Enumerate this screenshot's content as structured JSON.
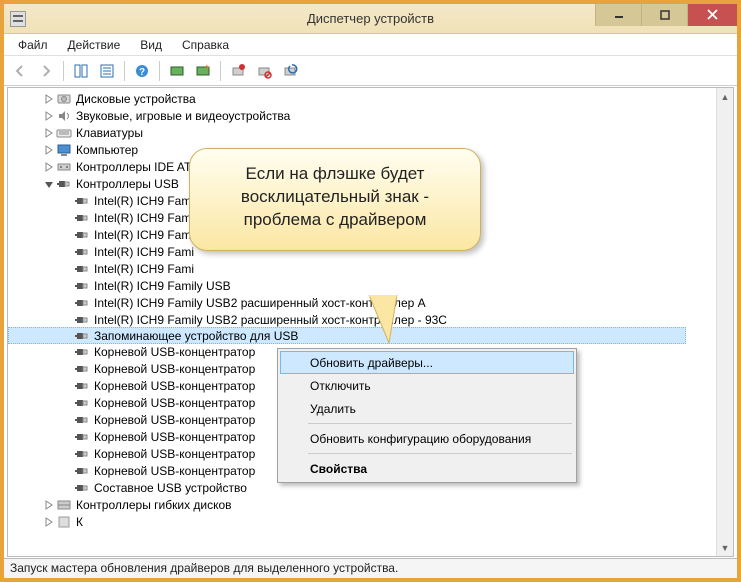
{
  "window": {
    "title": "Диспетчер устройств"
  },
  "menu": {
    "items": [
      "Файл",
      "Действие",
      "Вид",
      "Справка"
    ]
  },
  "tree": {
    "nodes": [
      {
        "indent": 1,
        "exp": "closed",
        "icon": "disk",
        "label": "Дисковые устройства"
      },
      {
        "indent": 1,
        "exp": "closed",
        "icon": "sound",
        "label": "Звуковые, игровые и видеоустройства"
      },
      {
        "indent": 1,
        "exp": "closed",
        "icon": "keyboard",
        "label": "Клавиатуры"
      },
      {
        "indent": 1,
        "exp": "closed",
        "icon": "computer",
        "label": "Компьютер"
      },
      {
        "indent": 1,
        "exp": "closed",
        "icon": "ide",
        "label": "Контроллеры IDE ATA"
      },
      {
        "indent": 1,
        "exp": "open",
        "icon": "usb",
        "label": "Контроллеры USB"
      },
      {
        "indent": 2,
        "exp": "none",
        "icon": "usb",
        "label": "Intel(R) ICH9 Fami"
      },
      {
        "indent": 2,
        "exp": "none",
        "icon": "usb",
        "label": "Intel(R) ICH9 Fami"
      },
      {
        "indent": 2,
        "exp": "none",
        "icon": "usb",
        "label": "Intel(R) ICH9 Fami"
      },
      {
        "indent": 2,
        "exp": "none",
        "icon": "usb",
        "label": "Intel(R) ICH9 Fami"
      },
      {
        "indent": 2,
        "exp": "none",
        "icon": "usb",
        "label": "Intel(R) ICH9 Fami"
      },
      {
        "indent": 2,
        "exp": "none",
        "icon": "usb",
        "label": "Intel(R) ICH9 Family USB"
      },
      {
        "indent": 2,
        "exp": "none",
        "icon": "usb",
        "label": "Intel(R) ICH9 Family USB2 расширенный хост-контроллер        A"
      },
      {
        "indent": 2,
        "exp": "none",
        "icon": "usb",
        "label": "Intel(R) ICH9 Family USB2 расширенный хост-контроллер - 93C"
      },
      {
        "indent": 2,
        "exp": "none",
        "icon": "usb",
        "label": "Запоминающее устройство для USB",
        "selected": true
      },
      {
        "indent": 2,
        "exp": "none",
        "icon": "usb",
        "label": "Корневой USB-концентратор"
      },
      {
        "indent": 2,
        "exp": "none",
        "icon": "usb",
        "label": "Корневой USB-концентратор"
      },
      {
        "indent": 2,
        "exp": "none",
        "icon": "usb",
        "label": "Корневой USB-концентратор"
      },
      {
        "indent": 2,
        "exp": "none",
        "icon": "usb",
        "label": "Корневой USB-концентратор"
      },
      {
        "indent": 2,
        "exp": "none",
        "icon": "usb",
        "label": "Корневой USB-концентратор"
      },
      {
        "indent": 2,
        "exp": "none",
        "icon": "usb",
        "label": "Корневой USB-концентратор"
      },
      {
        "indent": 2,
        "exp": "none",
        "icon": "usb",
        "label": "Корневой USB-концентратор"
      },
      {
        "indent": 2,
        "exp": "none",
        "icon": "usb",
        "label": "Корневой USB-концентратор"
      },
      {
        "indent": 2,
        "exp": "none",
        "icon": "usb",
        "label": "Составное USB устройство"
      },
      {
        "indent": 1,
        "exp": "closed",
        "icon": "floppy",
        "label": "Контроллеры гибких дисков"
      },
      {
        "indent": 1,
        "exp": "closed",
        "icon": "other",
        "label": "К"
      }
    ]
  },
  "context_menu": {
    "items": [
      {
        "label": "Обновить драйверы...",
        "hover": true
      },
      {
        "label": "Отключить"
      },
      {
        "label": "Удалить"
      },
      {
        "sep": true
      },
      {
        "label": "Обновить конфигурацию оборудования"
      },
      {
        "sep": true
      },
      {
        "label": "Свойства",
        "bold": true
      }
    ]
  },
  "callout": {
    "text": "Если на флэшке будет восклицательный знак - проблема с драйвером"
  },
  "status": {
    "text": "Запуск мастера обновления драйверов для выделенного устройства."
  }
}
